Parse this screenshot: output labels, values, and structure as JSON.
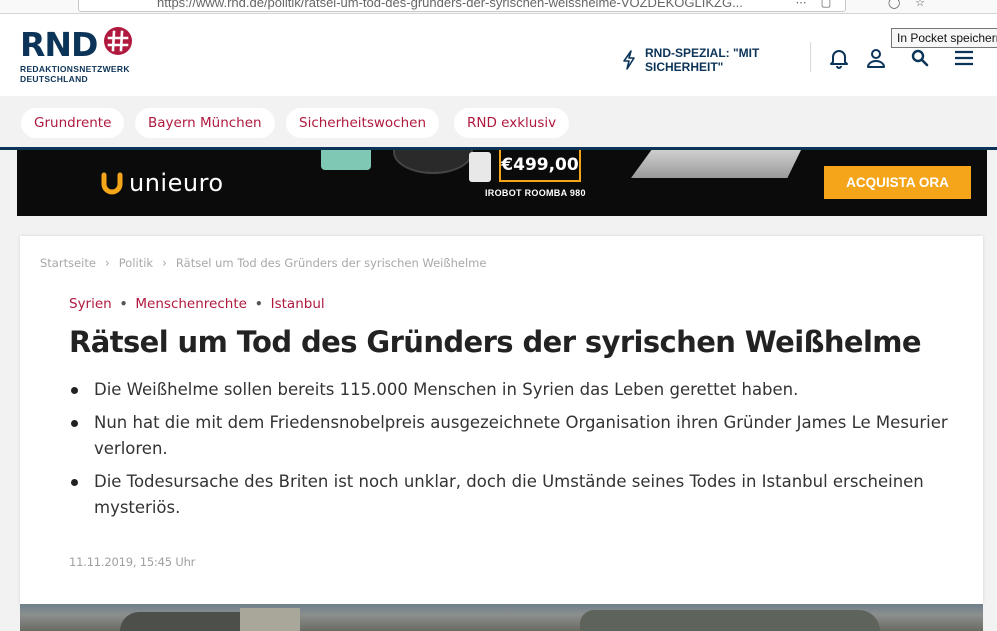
{
  "browser": {
    "url": "https://www.rnd.de/politik/ratsel-um-tod-des-grunders-der-syrischen-weisshelme-VOZDEKOGLIKZG...",
    "tooltip": "In Pocket speichern"
  },
  "header": {
    "logo_text": "RND",
    "logo_subtitle_line1": "REDAKTIONSNETZWERK",
    "logo_subtitle_line2": "DEUTSCHLAND",
    "spezial_label": "RND-SPEZIAL: \"MIT SICHERHEIT\"",
    "icons": [
      "bell-icon",
      "user-icon",
      "search-icon",
      "menu-icon"
    ]
  },
  "topics": [
    {
      "label": "Grundrente"
    },
    {
      "label": "Bayern München"
    },
    {
      "label": "Sicherheitswochen"
    },
    {
      "label": "RND exklusiv"
    }
  ],
  "ad": {
    "brand": "unieuro",
    "price": "€499,00",
    "product": "IROBOT ROOMBA 980",
    "cta": "ACQUISTA ORA",
    "accent_color": "#f5a51a"
  },
  "article": {
    "breadcrumb": [
      "Startseite",
      "Politik",
      "Rätsel um Tod des Gründers der syrischen Weißhelme"
    ],
    "tags": [
      "Syrien",
      "Menschenrechte",
      "Istanbul"
    ],
    "headline": "Rätsel um Tod des Gründers der syrischen Weißhelme",
    "summary": [
      "Die Weißhelme sollen bereits 115.000 Menschen in Syrien das Leben gerettet haben.",
      "Nun hat die mit dem Friedensnobelpreis ausgezeichnete Organisation ihren Gründer James Le Mesurier verloren.",
      "Die Todesursache des Briten ist noch unklar, doch die Umstände seines Todes in Istanbul erscheinen mysteriös."
    ],
    "date": "11.11.2019, 15:45 Uhr"
  },
  "colors": {
    "brand_navy": "#0c3458",
    "brand_red": "#b0193e"
  }
}
